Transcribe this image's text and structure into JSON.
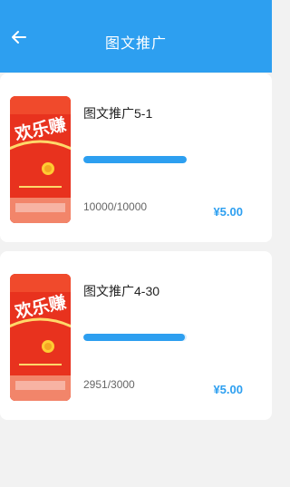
{
  "header": {
    "title": "图文推广",
    "back_icon": "arrow-left-icon"
  },
  "theme": {
    "accent": "#2d9ff0",
    "background": "#f2f2f2",
    "thumb_red": "#e8321e"
  },
  "items": [
    {
      "title": "图文推广5-1",
      "count": "10000/10000",
      "price": "¥5.00",
      "progress": 1.0,
      "thumb_text": "欢乐赚",
      "thumb_icon": "coin-icon"
    },
    {
      "title": "图文推广4-30",
      "count": "2951/3000",
      "price": "¥5.00",
      "progress": 0.98,
      "thumb_text": "欢乐赚",
      "thumb_icon": "coin-icon"
    }
  ]
}
